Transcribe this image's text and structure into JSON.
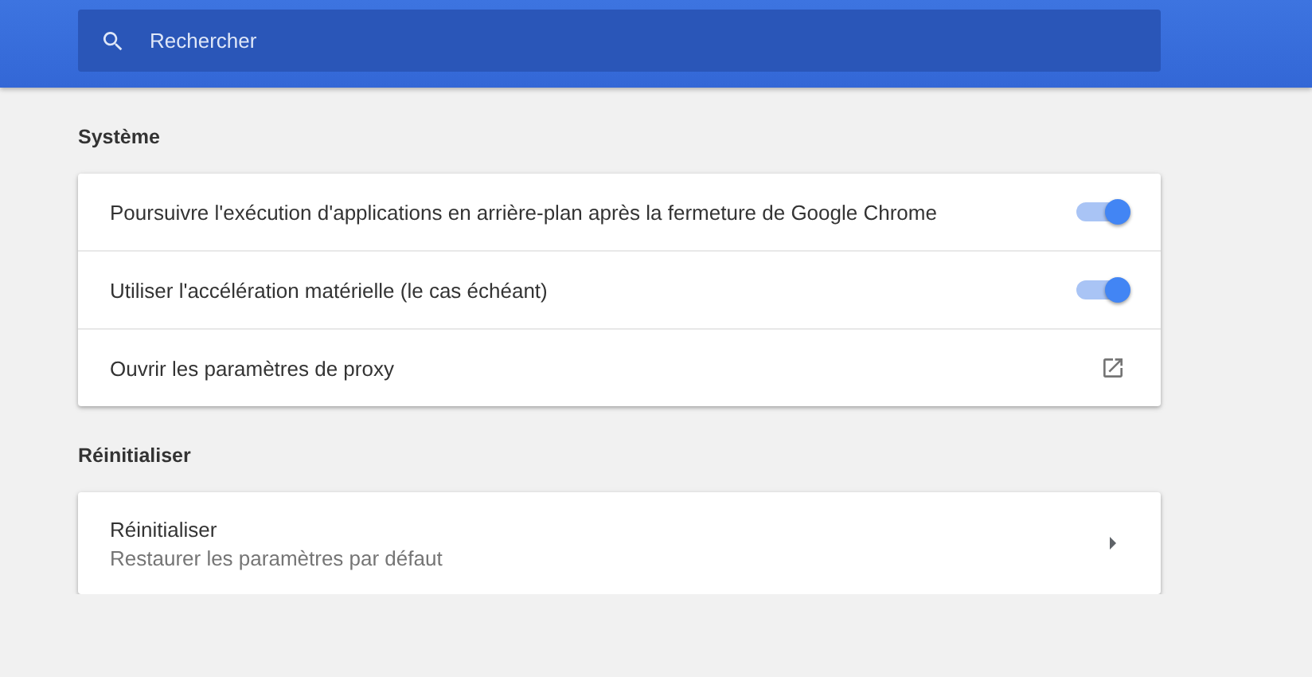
{
  "search": {
    "placeholder": "Rechercher"
  },
  "sections": [
    {
      "title": "Système",
      "rows": [
        {
          "kind": "toggle",
          "label": "Poursuivre l'exécution d'applications en arrière-plan après la fermeture de Google Chrome",
          "on": true
        },
        {
          "kind": "toggle",
          "label": "Utiliser l'accélération matérielle (le cas échéant)",
          "on": true
        },
        {
          "kind": "link",
          "label": "Ouvrir les paramètres de proxy"
        }
      ]
    },
    {
      "title": "Réinitialiser",
      "rows": [
        {
          "kind": "subpage",
          "label": "Réinitialiser",
          "sublabel": "Restaurer les paramètres par défaut"
        }
      ]
    }
  ]
}
